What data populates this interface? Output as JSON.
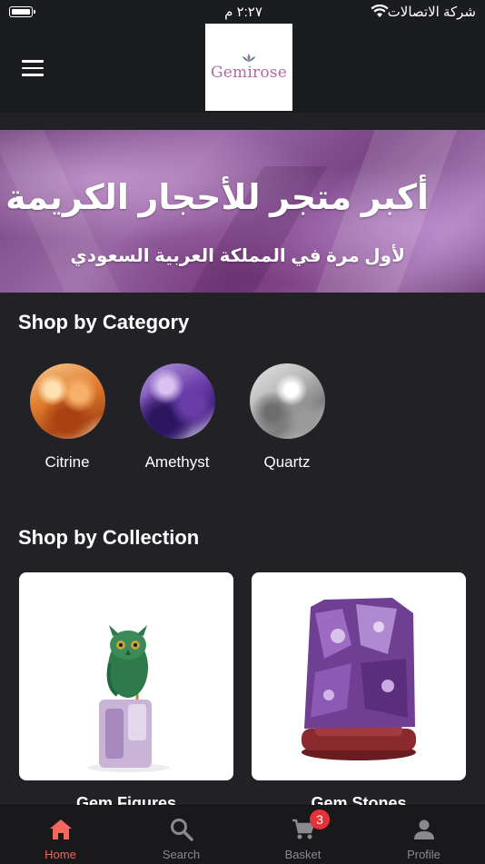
{
  "status_bar": {
    "time": "٢:٢٧ م",
    "carrier": "شركة الاتصالات"
  },
  "header": {
    "logo_text": "Gemirose"
  },
  "banner": {
    "title": "أكبر متجر للأحجار الكريمة",
    "subtitle": "لأول مرة في المملكة العربية السعودي"
  },
  "categories": {
    "title": "Shop by Category",
    "items": [
      {
        "label": "Citrine"
      },
      {
        "label": "Amethyst"
      },
      {
        "label": "Quartz"
      }
    ]
  },
  "collections": {
    "title": "Shop by Collection",
    "items": [
      {
        "label": "Gem Figures"
      },
      {
        "label": "Gem Stones"
      }
    ]
  },
  "bottom_nav": {
    "items": [
      {
        "label": "Home",
        "icon": "home-icon",
        "active": true
      },
      {
        "label": "Search",
        "icon": "search-icon"
      },
      {
        "label": "Basket",
        "icon": "cart-icon",
        "badge": "3"
      },
      {
        "label": "Profile",
        "icon": "profile-icon"
      }
    ]
  },
  "colors": {
    "background": "#222226",
    "header": "#1b1c1f",
    "accent": "#f2665d",
    "badge": "#e5323a",
    "brand": "#b16aa2"
  }
}
